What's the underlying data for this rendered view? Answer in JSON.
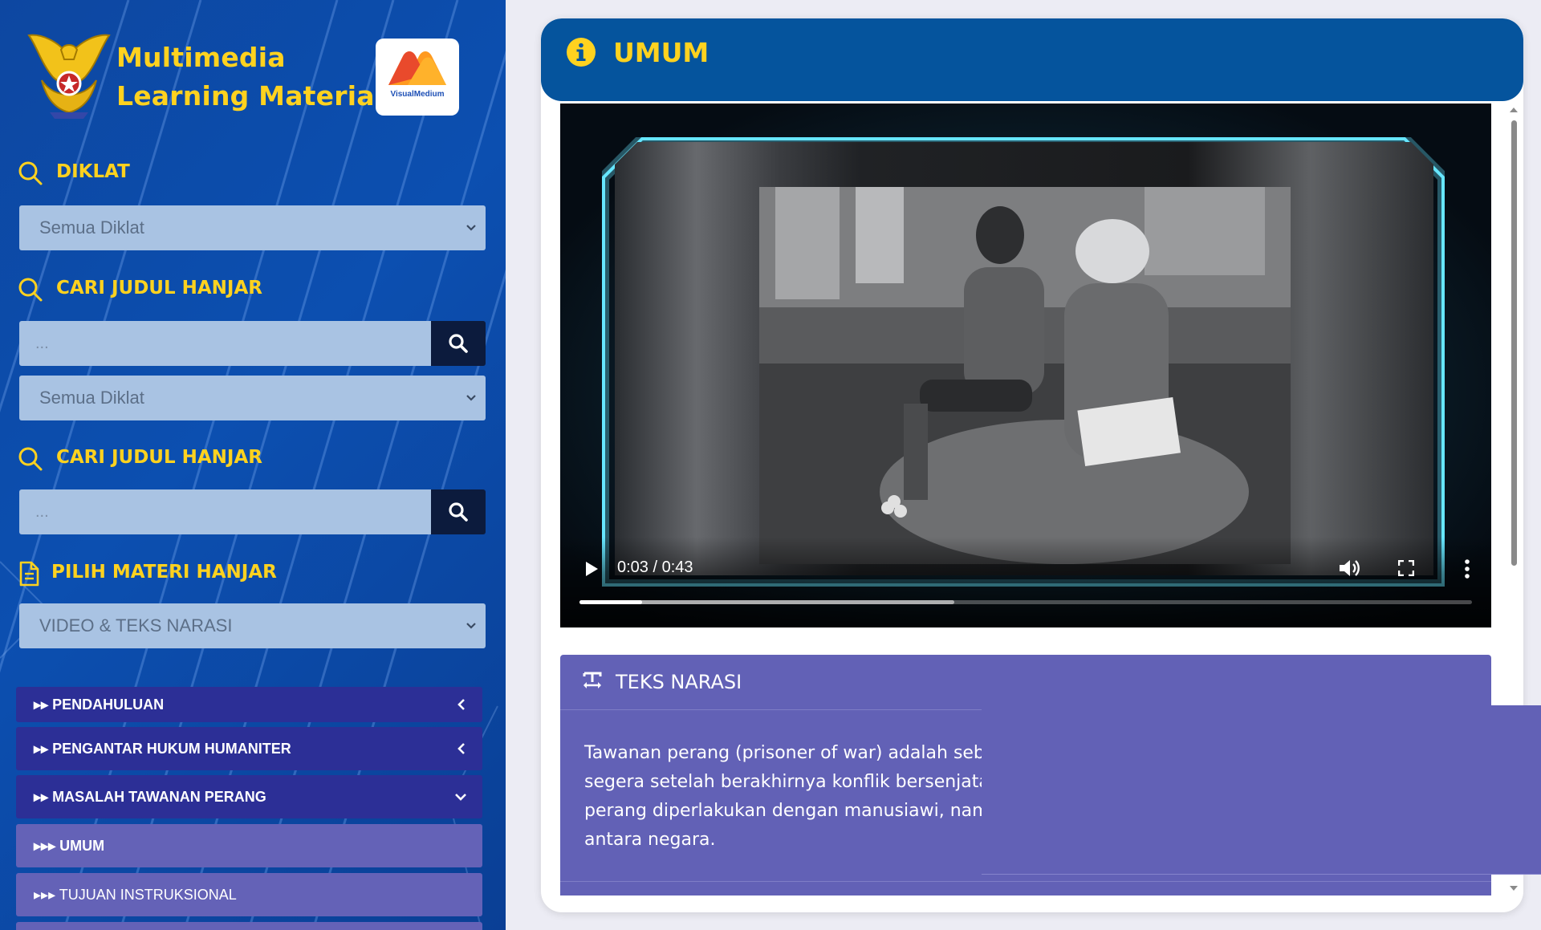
{
  "brand": {
    "title_line1": "Multimedia",
    "title_line2": "Learning Materials",
    "partner_logo_text": "VisualMedium"
  },
  "filters": {
    "diklat_heading": "DIKLAT",
    "diklat_select_value": "Semua Diklat",
    "search_heading": "CARI JUDUL HANJAR",
    "search_placeholder": "...",
    "diklat_select2_value": "Semua Diklat",
    "search_heading2": "CARI JUDUL HANJAR",
    "search2_placeholder": "...",
    "materi_heading": "PILIH MATERI HANJAR",
    "materi_select_value": "VIDEO & TEKS NARASI"
  },
  "menu": [
    {
      "label": "PENDAHULUAN",
      "state": "collapsed"
    },
    {
      "label": "PENGANTAR HUKUM HUMANITER",
      "state": "collapsed"
    },
    {
      "label": "MASALAH TAWANAN PERANG",
      "state": "expanded"
    },
    {
      "label": "UMUM",
      "state": "active-sub"
    },
    {
      "label": "TUJUAN INSTRUKSIONAL",
      "state": "sub"
    }
  ],
  "content": {
    "section_title": "UMUM",
    "video": {
      "time_display": "0:03 / 0:43",
      "played_fraction": 0.07,
      "buffered_fraction": 0.42
    },
    "narasi": {
      "title": "TEKS NARASI",
      "lines": [
        "Tawanan perang (prisoner of war) adalah sebuta",
        "segera setelah berakhirnya konflik bersenjata.",
        "perang diperlakukan dengan manusiawi, namu",
        "antara negara."
      ]
    }
  },
  "colors": {
    "sidebar_bg": "#0d47a1",
    "accent_yellow": "#ffd21f",
    "header_blue": "#05549d",
    "menu_parent": "#2c2f96",
    "menu_sub": "#6462b7"
  }
}
